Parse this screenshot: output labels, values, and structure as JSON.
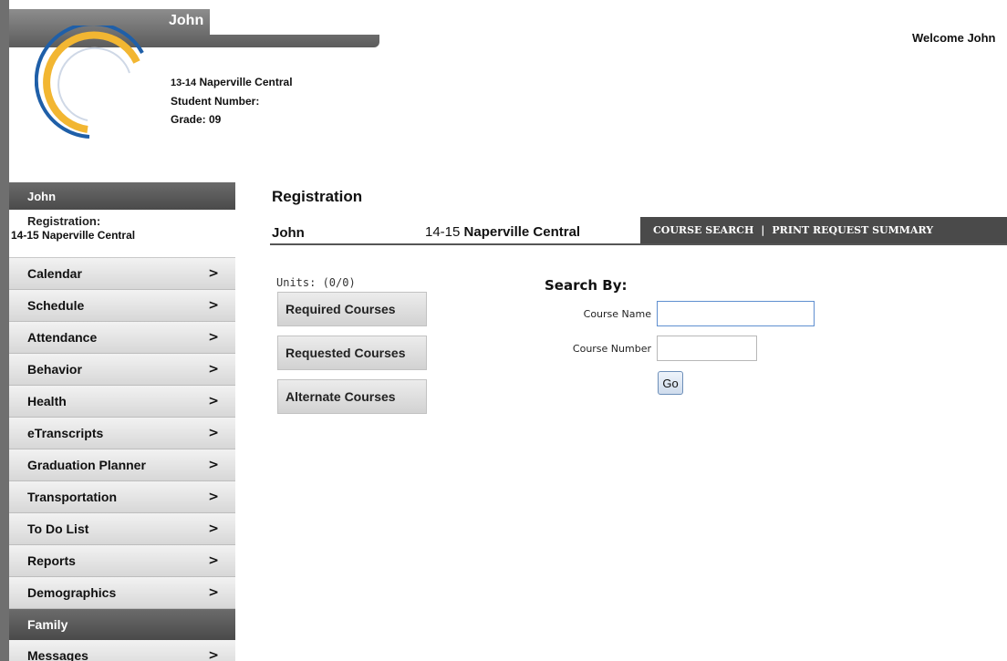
{
  "header": {
    "student_name": "John",
    "school_year_prefix": "13-14",
    "school_name": "Naperville Central",
    "student_number_label": "Student Number:",
    "grade_label": "Grade: 09",
    "welcome": "Welcome John"
  },
  "sidebar": {
    "header": "John",
    "registration_title": "Registration:",
    "registration_school_prefix": "14-15",
    "registration_school": "Naperville Central",
    "items": [
      {
        "label": "Calendar"
      },
      {
        "label": "Schedule"
      },
      {
        "label": "Attendance"
      },
      {
        "label": "Behavior"
      },
      {
        "label": "Health"
      },
      {
        "label": "eTranscripts"
      },
      {
        "label": "Graduation Planner"
      },
      {
        "label": "Transportation"
      },
      {
        "label": "To Do List"
      },
      {
        "label": "Reports"
      },
      {
        "label": "Demographics"
      }
    ],
    "family_header": "Family",
    "family_items": [
      {
        "label": "Messages"
      }
    ]
  },
  "main": {
    "title": "Registration",
    "student": "John",
    "school_prefix": "14-15",
    "school": "Naperville Central",
    "links": {
      "course_search": "COURSE SEARCH",
      "separator": "|",
      "print_summary": "PRINT REQUEST SUMMARY"
    },
    "units": "Units: (0/0)",
    "buttons": {
      "required": "Required Courses",
      "requested": "Requested Courses",
      "alternate": "Alternate Courses"
    },
    "search": {
      "title": "Search By:",
      "course_name_label": "Course Name",
      "course_name_value": "",
      "course_number_label": "Course Number",
      "course_number_value": "",
      "go_label": "Go"
    }
  },
  "colors": {
    "header_gray": "#5c5c5c",
    "sidebar_item_bg": "#e3e3e3",
    "logo_blue": "#1f5fa8",
    "logo_gold": "#f2b632"
  }
}
